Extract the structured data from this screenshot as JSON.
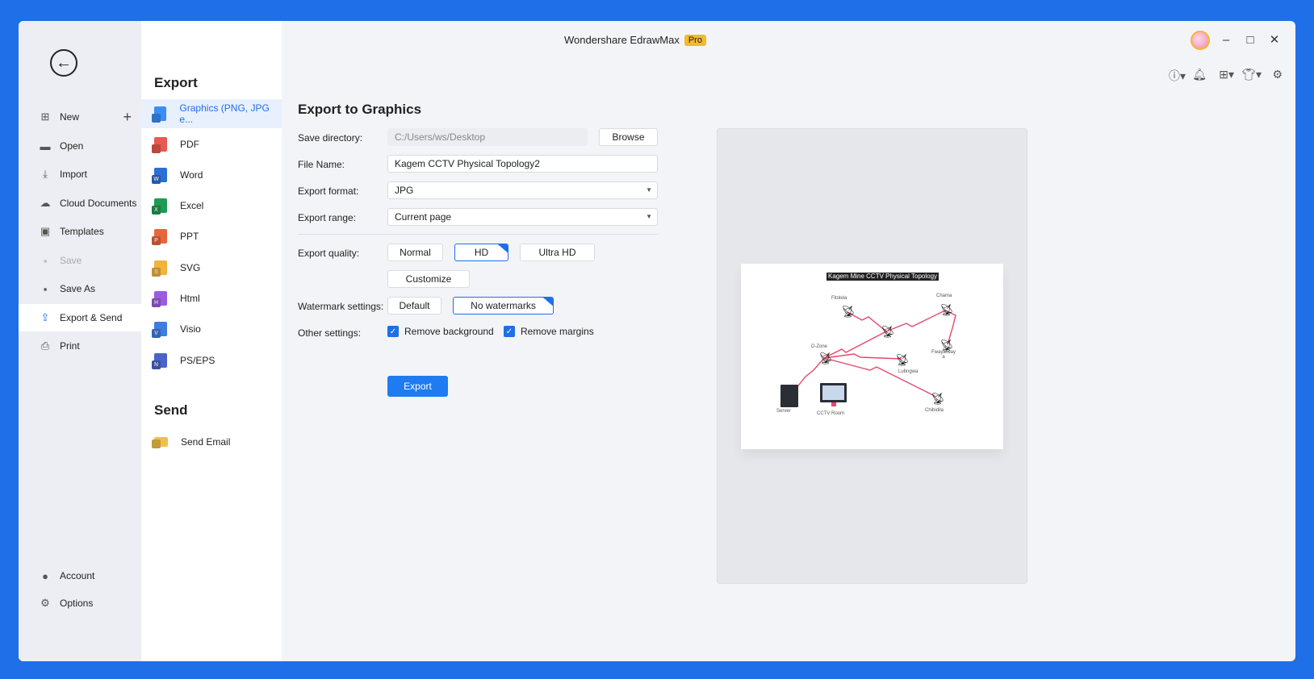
{
  "window": {
    "app_title": "Wondershare EdrawMax",
    "pro_badge": "Pro",
    "controls": {
      "minimize": "–",
      "maximize": "□",
      "close": "✕"
    }
  },
  "leftnav": {
    "items": [
      {
        "label": "New",
        "icon": "plus-square-icon"
      },
      {
        "label": "Open",
        "icon": "folder-icon"
      },
      {
        "label": "Import",
        "icon": "import-icon"
      },
      {
        "label": "Cloud Documents",
        "icon": "cloud-icon"
      },
      {
        "label": "Templates",
        "icon": "templates-icon"
      },
      {
        "label": "Save",
        "icon": "save-icon",
        "disabled": true
      },
      {
        "label": "Save As",
        "icon": "save-as-icon"
      },
      {
        "label": "Export & Send",
        "icon": "export-icon",
        "active": true
      },
      {
        "label": "Print",
        "icon": "print-icon"
      }
    ],
    "bottom": [
      {
        "label": "Account",
        "icon": "user-icon"
      },
      {
        "label": "Options",
        "icon": "gear-icon"
      }
    ]
  },
  "typepanel": {
    "export_heading": "Export",
    "types": [
      {
        "label": "Graphics (PNG, JPG e...",
        "color": "#3a8ef6",
        "letter": "",
        "active": true
      },
      {
        "label": "PDF",
        "color": "#e85a4f",
        "letter": ""
      },
      {
        "label": "Word",
        "color": "#2b6fd6",
        "letter": "W"
      },
      {
        "label": "Excel",
        "color": "#1e9a52",
        "letter": "X"
      },
      {
        "label": "PPT",
        "color": "#e8663c",
        "letter": "P"
      },
      {
        "label": "SVG",
        "color": "#f2b33d",
        "letter": "S"
      },
      {
        "label": "Html",
        "color": "#9b5ce0",
        "letter": "H"
      },
      {
        "label": "Visio",
        "color": "#3f7de0",
        "letter": "V"
      },
      {
        "label": "PS/EPS",
        "color": "#4a63c9",
        "letter": "N"
      }
    ],
    "send_heading": "Send",
    "send_items": [
      {
        "label": "Send Email",
        "icon": "email-icon"
      }
    ]
  },
  "form": {
    "title": "Export to Graphics",
    "save_directory_label": "Save directory:",
    "save_directory_value": "C:/Users/ws/Desktop",
    "browse_label": "Browse",
    "file_name_label": "File Name:",
    "file_name_value": "Kagem CCTV Physical Topology2",
    "export_format_label": "Export format:",
    "export_format_value": "JPG",
    "export_range_label": "Export range:",
    "export_range_value": "Current page",
    "quality_label": "Export quality:",
    "quality_options": [
      "Normal",
      "HD",
      "Ultra HD"
    ],
    "quality_selected": "HD",
    "customize_label": "Customize",
    "watermark_label": "Watermark settings:",
    "watermark_options": [
      "Default",
      "No watermarks"
    ],
    "watermark_selected": "No watermarks",
    "other_label": "Other settings:",
    "remove_background_label": "Remove background",
    "remove_background_checked": true,
    "remove_margins_label": "Remove margins",
    "remove_margins_checked": true,
    "export_button": "Export"
  },
  "preview": {
    "diagram_title": "Kagem Mine CCTV Physical Topology",
    "node_labels": [
      "Fitolela",
      "Chama",
      "D-Zone",
      "Fwayafway a",
      "Lubngwa",
      "Server",
      "CCTV Room",
      "Chibidila"
    ],
    "link_color": "#e8476a"
  },
  "accent_color": "#1f6fe8"
}
